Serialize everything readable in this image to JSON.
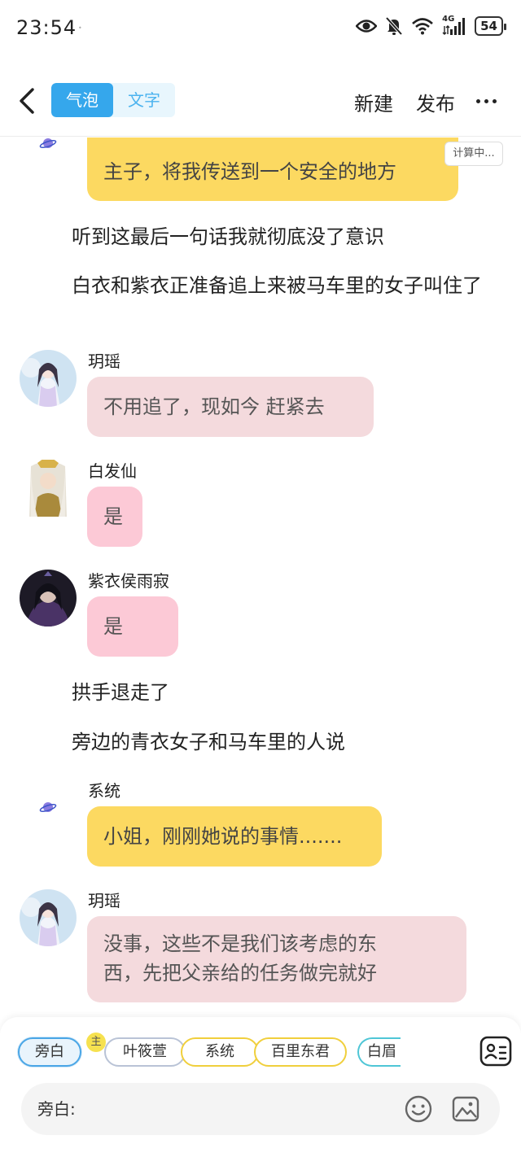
{
  "status_bar": {
    "time": "23:54",
    "network": "4G",
    "battery": "54",
    "icons": [
      "eye-icon",
      "mute-bell-icon",
      "wifi-icon",
      "signal-icon",
      "battery-icon"
    ]
  },
  "header": {
    "tabs": [
      {
        "label": "气泡",
        "active": true
      },
      {
        "label": "文字",
        "active": false
      }
    ],
    "new_label": "新建",
    "publish_label": "发布"
  },
  "messages": {
    "m1": {
      "text": "主子，将我传送到一个安全的地方",
      "style": "yellow",
      "status_badge": "计算中..."
    },
    "n1": "听到这最后一句话我就彻底没了意识",
    "n2": "白衣和紫衣正准备追上来被马车里的女子叫住了",
    "m2": {
      "name": "玥瑶",
      "text": "不用追了，现如今 赶紧去",
      "style": "rose"
    },
    "m3": {
      "name": "白发仙",
      "text": "是",
      "style": "pink"
    },
    "m4": {
      "name": "紫衣侯雨寂",
      "text": "是",
      "style": "pink"
    },
    "n3": "拱手退走了",
    "n4": "旁边的青衣女子和马车里的人说",
    "m5": {
      "name": "系统",
      "text": "小姐，刚刚她说的事情.......",
      "style": "yellow"
    },
    "m6": {
      "name": "玥瑶",
      "text_line1": "没事，这些不是我们该考虑的东",
      "text_line2": "西，先把父亲给的任务做完就好",
      "style": "rose"
    }
  },
  "composer": {
    "host_badge": "主",
    "roles": [
      "旁白",
      "叶筱萱",
      "系统",
      "百里东君",
      "白眉"
    ],
    "selected_role": "旁白",
    "input_placeholder": "旁白:"
  },
  "colors": {
    "accent_blue": "#35a7ec",
    "bubble_yellow": "#fcd961",
    "bubble_pink": "#fcc9d6",
    "bubble_rose": "#f4dadd"
  }
}
